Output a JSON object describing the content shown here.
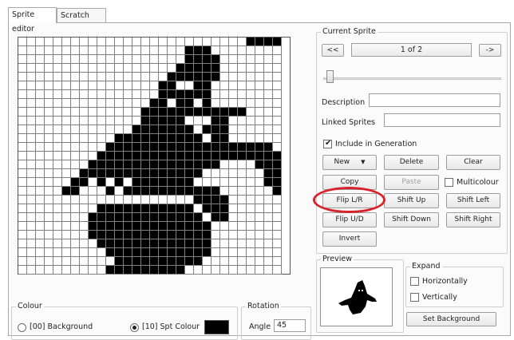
{
  "tabs": [
    {
      "label": "Sprite editor",
      "active": true
    },
    {
      "label": "Scratch pad",
      "active": false
    }
  ],
  "sprite_grid": {
    "cols": 30,
    "rows": 27,
    "pixels": [
      "..........................####",
      "...................###........",
      "...................####.......",
      "..................#####.......",
      ".................######.......",
      "................##..##........",
      "................######........",
      "...............##.##.#........",
      "..............############....",
      "..............#####...##......",
      ".............#######.###......",
      "...........##########.##......",
      "..........###################.",
      ".........#####################",
      "........###############....###",
      ".......##############.......##",
      "......##.#.#.#######........##",
      ".....##...#.###########......#",
      "....................####......",
      ".........###########.###......",
      "........#############.##......",
      "........##############........",
      "........##############........",
      ".........#############........",
      "..........############........",
      "...........##########.........",
      "..........#########..........."
    ]
  },
  "current_sprite": {
    "title": "Current Sprite",
    "prev_label": "<<",
    "next_label": "->",
    "counter": "1 of 2",
    "slider_fraction": 0.0
  },
  "fields": {
    "description_label": "Description",
    "description_value": "",
    "linked_label": "Linked Sprites",
    "linked_value": "",
    "include_label": "Include in Generation",
    "include_checked": true
  },
  "buttons": {
    "new": "New",
    "delete": "Delete",
    "clear": "Clear",
    "copy": "Copy",
    "paste": "Paste",
    "multicolour": "Multicolour",
    "flip_lr": "Flip L/R",
    "shift_up": "Shift Up",
    "shift_left": "Shift Left",
    "flip_ud": "Flip U/D",
    "shift_down": "Shift Down",
    "shift_right": "Shift Right",
    "invert": "Invert"
  },
  "preview": {
    "title": "Preview",
    "expand_title": "Expand",
    "horizontally": "Horizontally",
    "vertically": "Vertically",
    "set_background": "Set Background"
  },
  "colour": {
    "title": "Colour",
    "background_option": "[00] Background",
    "sprite_option": "[10] Spt Colour",
    "selected": "sprite",
    "swatch_color": "#000000"
  },
  "rotation": {
    "title": "Rotation",
    "angle_label": "Angle",
    "angle_value": "45"
  },
  "highlight_color": "#d9232b"
}
